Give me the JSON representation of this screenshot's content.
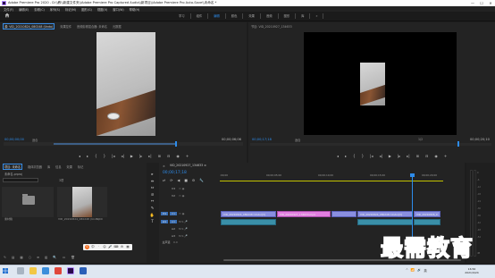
{
  "window": {
    "title": "Adobe Premiere Pro 2020 - D:\\\\教\\\\新建文件夹\\\\Adobe Premiere Pro Captured Audio\\\\新项目\\\\Adobe Premiere Pro Auto-Save\\\\未命名 *",
    "minimize": "—",
    "maximize": "☐",
    "close": "✕"
  },
  "menu": [
    "文件(F)",
    "编辑(E)",
    "剪辑(C)",
    "序列(S)",
    "标记(M)",
    "图形(G)",
    "视图(V)",
    "窗口(W)",
    "帮助(H)"
  ],
  "workspaces": [
    "学习",
    "组件",
    "编辑",
    "颜色",
    "效果",
    "音频",
    "图形",
    "库",
    "»"
  ],
  "source": {
    "tabs": [
      "源: VID_20210824_080248 (Undo)",
      "效果控件",
      "音频剪辑混合器: 未命名",
      "元数据"
    ],
    "timecode_in": "00;00;00;00",
    "fit": "适合",
    "timecode_out": "00;00;06;06",
    "controls": [
      "◂",
      "▸",
      "{",
      "}",
      "|◂",
      "◂|",
      "▶",
      "|▸",
      "▸|",
      "⊞",
      "⊟",
      "◉",
      "+"
    ]
  },
  "program": {
    "tabs": [
      "节目: VID_20210927_134633"
    ],
    "timecode_in": "00;00;17;18",
    "fit": "适合",
    "fraction": "1/2",
    "timecode_out": "00;00;20;10",
    "controls": [
      "◂",
      "▸",
      "{",
      "}",
      "|◂",
      "◂|",
      "▶",
      "|▸",
      "▸|",
      "⊞",
      "⊟",
      "◉",
      "+"
    ]
  },
  "project": {
    "tabs": [
      "项目: 未命名",
      "媒体浏览器",
      "库",
      "信息",
      "效果",
      "标记"
    ],
    "name": "未命名.prproj",
    "count": "3项",
    "items": [
      {
        "label": "素材箱",
        "duration": ""
      },
      {
        "label": "VID_20210824_080248 (Undo)",
        "duration": "5:00"
      }
    ],
    "bottom_icons": [
      "✎",
      "▤",
      "▦",
      "○",
      "≡",
      "▥",
      "🔍",
      "▭",
      "🗑"
    ]
  },
  "ime": [
    "S",
    "中",
    "⸱",
    "☺",
    "🎤",
    "⌨",
    "⚙",
    "▦"
  ],
  "tools": [
    "▸",
    "⇹",
    "⇔",
    "⊘",
    "↔",
    "✎",
    "✋",
    "T"
  ],
  "timeline": {
    "close": "×",
    "tab": "VID_20210927_134633 ≡",
    "timecode": "00;00;17;18",
    "tools": [
      "⇄",
      "⟳",
      "◀",
      "■",
      "⚙",
      "🔧"
    ],
    "ruler": [
      ":00;00",
      "00;00;05;00",
      "00;00;10;00",
      "00;00;15;00",
      "00;00;20;00"
    ],
    "tracks": [
      {
        "target": "",
        "name": "V3",
        "icons": "▭ ◉"
      },
      {
        "target": "",
        "name": "V2",
        "icons": "▭ ◉"
      },
      {
        "target": "V1",
        "name": "V1",
        "icons": "▭ ◉"
      },
      {
        "target": "A1",
        "name": "A1",
        "icons": "M S 🎤"
      },
      {
        "target": "",
        "name": "A2",
        "icons": "M S 🎤"
      },
      {
        "target": "",
        "name": "A3",
        "icons": "M S 🎤"
      },
      {
        "target": "",
        "name": "主声道",
        "icons": "0.0"
      }
    ],
    "video_clips": [
      {
        "name": "VID_20210824_080248 (Undo)[V]"
      },
      {
        "name": "VID_20210927_134633.mp4"
      },
      {
        "name": "VID_20210824_080248 (Undo)[V]"
      },
      {
        "name": "VID_20210826_0"
      }
    ],
    "mix_label": "混合"
  },
  "meters": {
    "labels": [
      "0",
      "-6",
      "-12",
      "-18",
      "-24",
      "-30",
      "-36",
      "-42",
      "-48",
      "-54",
      "dB"
    ],
    "solo": [
      "S",
      "S"
    ]
  },
  "watermark": "最需教育",
  "taskbar": {
    "tray": [
      "^",
      "📶",
      "🔊",
      "英"
    ],
    "time": "16:56",
    "date": "2021/9/24"
  }
}
